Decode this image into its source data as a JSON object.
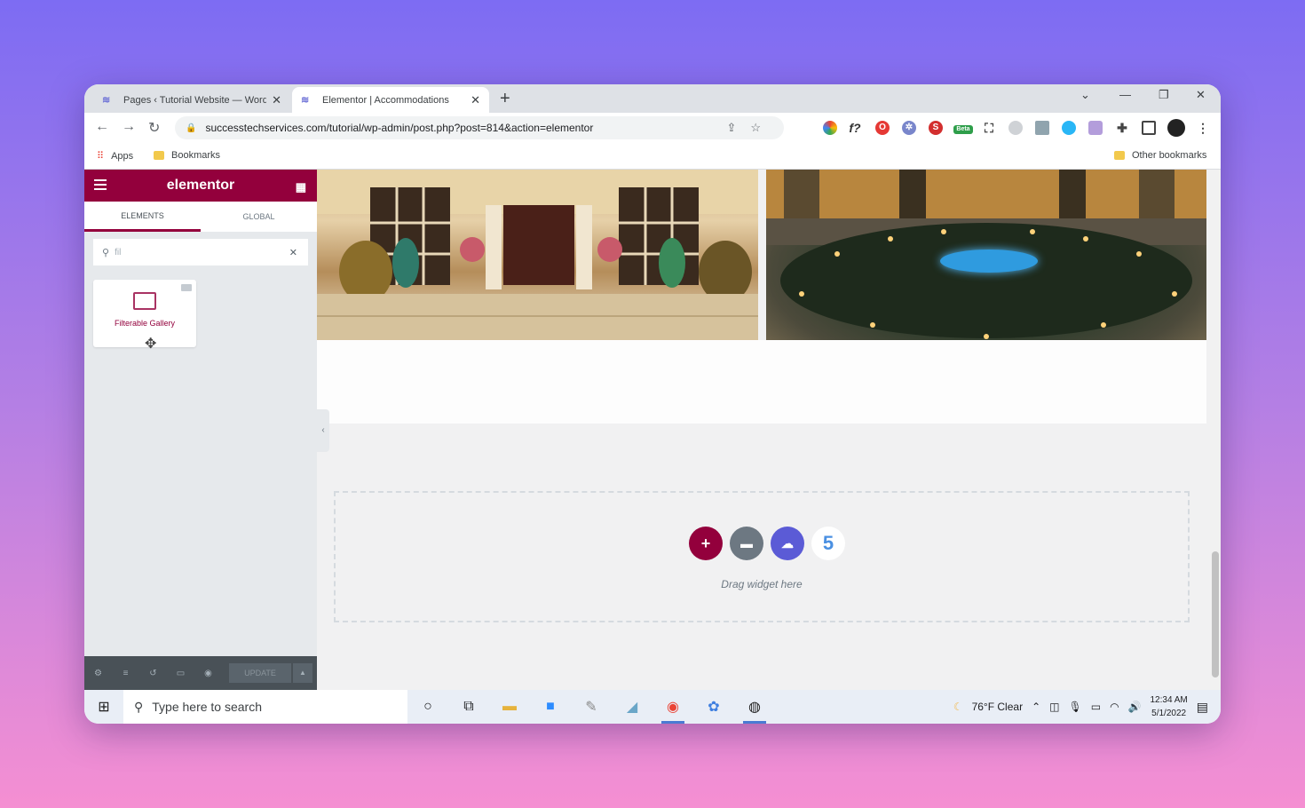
{
  "browser": {
    "tabs": [
      {
        "title": "Pages ‹ Tutorial Website — Word",
        "active": false
      },
      {
        "title": "Elementor | Accommodations",
        "active": true
      }
    ],
    "url": "successtechservices.com/tutorial/wp-admin/post.php?post=814&action=elementor",
    "bookmarks": {
      "apps": "Apps",
      "bookmarks": "Bookmarks",
      "other": "Other bookmarks"
    },
    "extension_beta_label": "Beta"
  },
  "elementor": {
    "logo": "elementor",
    "tabs": [
      "ELEMENTS",
      "GLOBAL"
    ],
    "search_value": "fil",
    "widget_label": "Filterable Gallery",
    "footer": {
      "update_label": "UPDATE"
    },
    "drag_text": "Drag widget here",
    "brand_color": "#93003c"
  },
  "taskbar": {
    "search_placeholder": "Type here to search",
    "weather": "76°F  Clear",
    "time": "12:34 AM",
    "date": "5/1/2022"
  }
}
